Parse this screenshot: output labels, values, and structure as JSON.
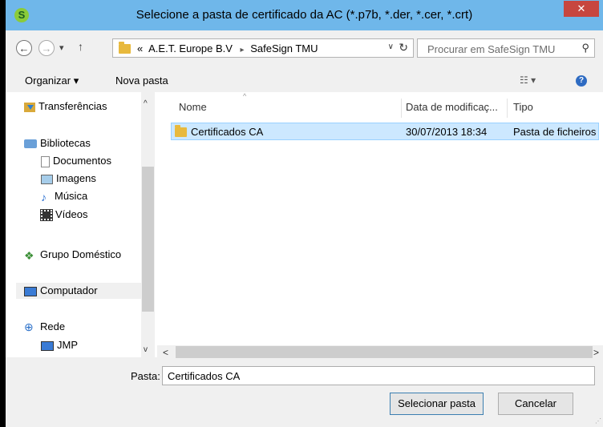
{
  "window": {
    "title": "Selecione a pasta de certificado da AC (*.p7b, *.der, *.cer, *.crt)",
    "app_icon_glyph": "S",
    "close_glyph": "✕",
    "titlebar_color": "#6fb7ea",
    "close_color": "#c7463f"
  },
  "address_bar": {
    "back_glyph": "←",
    "forward_glyph": "→",
    "recent_glyph": "▾",
    "up_glyph": "↑",
    "overflow": "«",
    "crumbs": [
      "A.E.T. Europe B.V",
      "SafeSign TMU"
    ],
    "crumb_separator": "▸",
    "dropdown_glyph": "∨",
    "refresh_glyph": "↻"
  },
  "search": {
    "placeholder": "Procurar em SafeSign TMU",
    "icon": "search-icon",
    "icon_glyph": "⚲"
  },
  "toolbar": {
    "organize_label": "Organizar ▾",
    "new_folder_label": "Nova pasta",
    "views_glyph": "☷ ▾",
    "help_glyph": "?"
  },
  "nav_pane": {
    "items": [
      {
        "label": "Transferências",
        "icon": "downloads-icon"
      },
      {
        "label": "Bibliotecas",
        "icon": "libraries-icon"
      },
      {
        "label": "Documentos",
        "icon": "documents-icon"
      },
      {
        "label": "Imagens",
        "icon": "pictures-icon"
      },
      {
        "label": "Música",
        "icon": "music-icon",
        "glyph": "♪"
      },
      {
        "label": "Vídeos",
        "icon": "videos-icon"
      },
      {
        "label": "Grupo Doméstico",
        "icon": "homegroup-icon",
        "glyph": "❖"
      },
      {
        "label": "Computador",
        "icon": "computer-icon"
      },
      {
        "label": "Rede",
        "icon": "network-icon",
        "glyph": "⊕"
      },
      {
        "label": "JMP",
        "icon": "computer-icon"
      }
    ],
    "scroll_up_glyph": "^",
    "scroll_down_glyph": "v"
  },
  "file_list": {
    "columns": [
      "Nome",
      "Data de modificaç...",
      "Tipo"
    ],
    "sort_glyph": "^",
    "rows": [
      {
        "name": "Certificados CA",
        "date": "30/07/2013 18:34",
        "type": "Pasta de ficheiros"
      }
    ],
    "scroll_left_glyph": "<",
    "scroll_right_glyph": ">"
  },
  "footer": {
    "folder_label": "Pasta:",
    "folder_value": "Certificados CA",
    "select_button": "Selecionar pasta",
    "cancel_button": "Cancelar",
    "grip_glyph": "⋰"
  }
}
